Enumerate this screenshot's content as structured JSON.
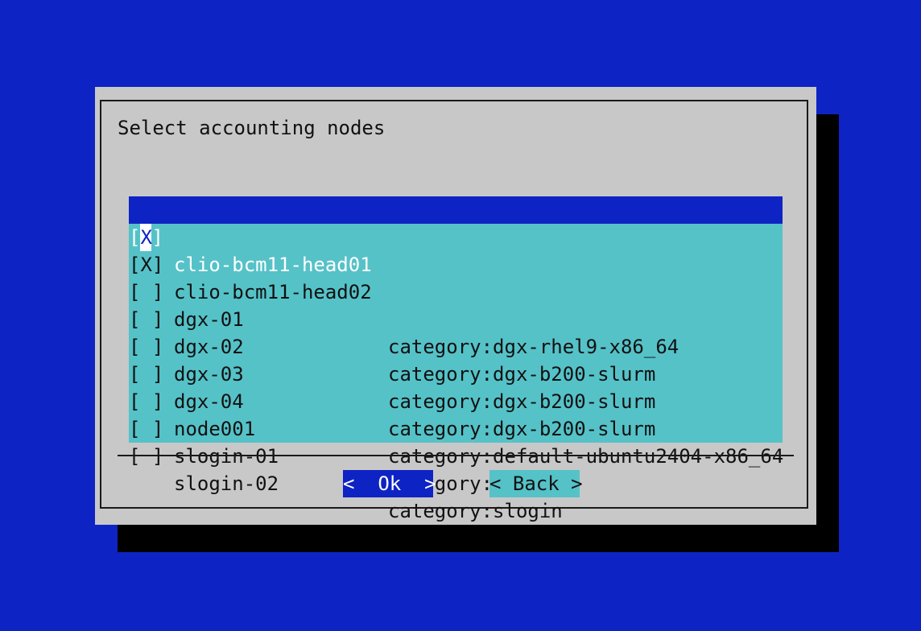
{
  "dialog": {
    "title": "Select accounting nodes",
    "items": [
      {
        "check": "[X]",
        "name": "clio-bcm11-head01",
        "category": "",
        "selected": true
      },
      {
        "check": "[X]",
        "name": "clio-bcm11-head02",
        "category": "",
        "selected": false
      },
      {
        "check": "[ ]",
        "name": "dgx-01",
        "category": "category:dgx-rhel9-x86_64",
        "selected": false
      },
      {
        "check": "[ ]",
        "name": "dgx-02",
        "category": "category:dgx-b200-slurm",
        "selected": false
      },
      {
        "check": "[ ]",
        "name": "dgx-03",
        "category": "category:dgx-b200-slurm",
        "selected": false
      },
      {
        "check": "[ ]",
        "name": "dgx-04",
        "category": "category:dgx-b200-slurm",
        "selected": false
      },
      {
        "check": "[ ]",
        "name": "node001",
        "category": "category:default-ubuntu2404-x86_64",
        "selected": false
      },
      {
        "check": "[ ]",
        "name": "slogin-01",
        "category": "category:slogin",
        "selected": false
      },
      {
        "check": "[ ]",
        "name": "slogin-02",
        "category": "category:slogin",
        "selected": false
      }
    ],
    "buttons": {
      "ok": "<  Ok  >",
      "back": "< Back >"
    }
  },
  "colors": {
    "background": "#0e23c4",
    "dialog": "#c8c8c8",
    "list": "#55c2c8",
    "highlight": "#0e23c4"
  }
}
